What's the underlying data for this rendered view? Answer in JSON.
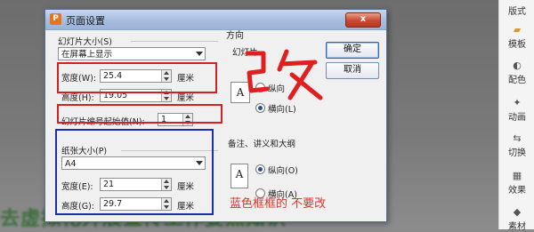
{
  "dialog": {
    "title": "页面设置",
    "app_icon_letter": "P",
    "close_label": "x",
    "slide_size": {
      "section_label": "幻灯片大小(S)",
      "selected": "在屏幕上显示",
      "width_label": "宽度(W):",
      "width_value": "25.4",
      "height_label": "高度(H):",
      "height_value": "19.05",
      "unit": "厘米",
      "numbering_label": "幻灯片编号起始值(N):",
      "numbering_value": "1"
    },
    "paper_size": {
      "section_label": "纸张大小(P)",
      "selected": "A4",
      "width_label": "宽度(E):",
      "width_value": "21",
      "height_label": "高度(G):",
      "height_value": "29.7",
      "unit": "厘米"
    },
    "orientation": {
      "section_label": "方向",
      "slides_label": "幻灯片",
      "slides_portrait": "纵向",
      "slides_landscape": "横向(L)",
      "notes_label": "备注、讲义和大纲",
      "notes_portrait": "纵向(O)",
      "notes_landscape": "横向(A)",
      "icon_letter": "A"
    },
    "ok_label": "确定",
    "cancel_label": "取消"
  },
  "annotations": {
    "scrawl_text": "改",
    "blue_note": "蓝色框框的 不要改"
  },
  "side_pane": {
    "items": [
      {
        "label": "版式",
        "icon": "layout-icon"
      },
      {
        "label": "模板",
        "icon": "template-icon"
      },
      {
        "label": "配色",
        "icon": "palette-icon"
      },
      {
        "label": "动画",
        "icon": "animation-icon"
      },
      {
        "label": "切换",
        "icon": "transition-icon"
      },
      {
        "label": "效果",
        "icon": "effects-icon"
      },
      {
        "label": "素材",
        "icon": "material-icon"
      }
    ]
  },
  "background": {
    "slide_text": "去虚拟化开展宣传工作要点知识"
  },
  "colors": {
    "red_annotation": "#d42020",
    "blue_annotation": "#1b2fa8",
    "note_text": "#e0342a",
    "titlebar": "#a9bfe0"
  }
}
